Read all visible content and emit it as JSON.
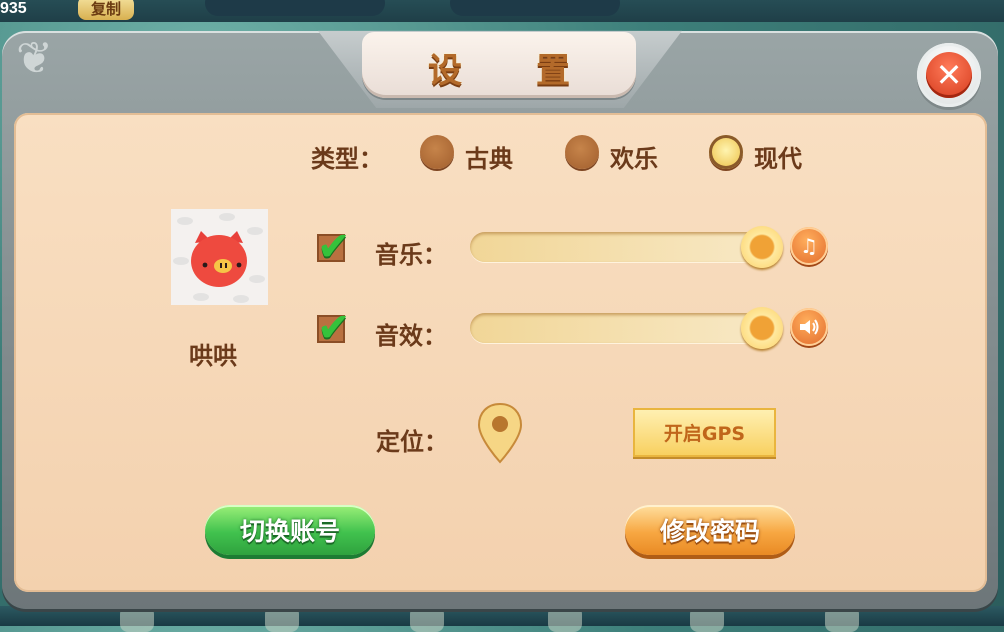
{
  "background": {
    "score": "935",
    "copy_label": "复制"
  },
  "title": {
    "char1": "设",
    "char2": "置"
  },
  "type_row": {
    "label": "类型：",
    "options": [
      {
        "label": "古典",
        "selected": false
      },
      {
        "label": "欢乐",
        "selected": false
      },
      {
        "label": "现代",
        "selected": true
      }
    ]
  },
  "profile": {
    "nickname": "哄哄"
  },
  "music": {
    "label": "音乐：",
    "enabled": true,
    "level_percent": 100,
    "icon": "music-note-icon"
  },
  "sound": {
    "label": "音效：",
    "enabled": true,
    "level_percent": 100,
    "icon": "speaker-icon"
  },
  "location": {
    "label": "定位：",
    "gps_button": "开启GPS"
  },
  "buttons": {
    "switch_account": "切换账号",
    "change_password": "修改密码"
  },
  "colors": {
    "panel": "#f6d8b8",
    "label": "#6b3a1a",
    "accent_orange": "#f7a742",
    "accent_green": "#41c24e"
  }
}
